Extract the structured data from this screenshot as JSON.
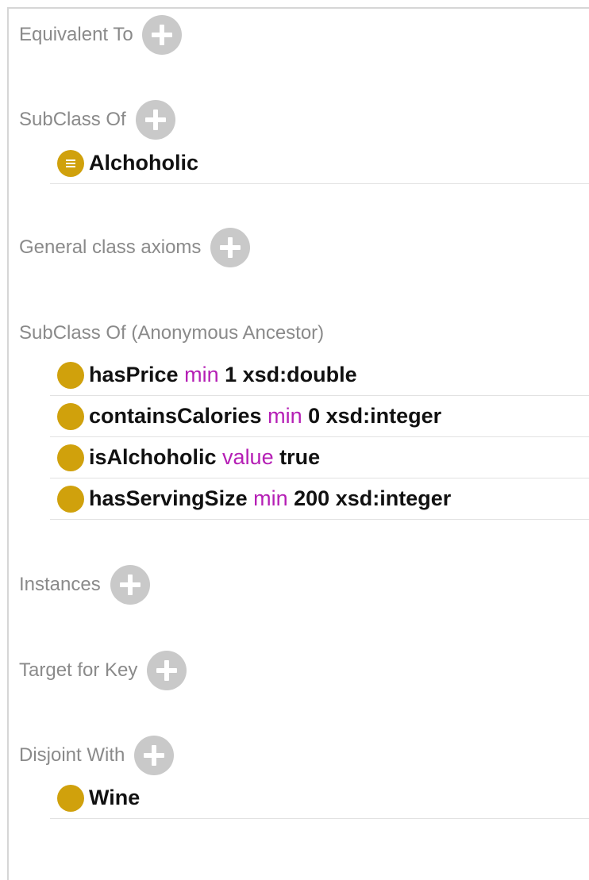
{
  "sections": {
    "equivalent_to": {
      "label": "Equivalent To"
    },
    "subclass_of": {
      "label": "SubClass Of",
      "items": [
        {
          "text": "Alchoholic"
        }
      ]
    },
    "general_class_axioms": {
      "label": "General class axioms"
    },
    "subclass_of_anonymous": {
      "label": "SubClass Of (Anonymous Ancestor)",
      "items": [
        {
          "property": "hasPrice",
          "keyword": "min",
          "value": "1 xsd:double"
        },
        {
          "property": "containsCalories",
          "keyword": "min",
          "value": "0 xsd:integer"
        },
        {
          "property": "isAlchoholic",
          "keyword": "value",
          "value": "true"
        },
        {
          "property": "hasServingSize",
          "keyword": "min",
          "value": "200 xsd:integer"
        }
      ]
    },
    "instances": {
      "label": "Instances"
    },
    "target_for_key": {
      "label": "Target for Key"
    },
    "disjoint_with": {
      "label": "Disjoint With",
      "items": [
        {
          "text": "Wine"
        }
      ]
    }
  },
  "colors": {
    "bullet": "#d0a10c",
    "keyword": "#b51fb5",
    "label": "#8a8a8a",
    "add_button": "#c9c9c9"
  },
  "icons": {
    "add": "plus-circle-icon",
    "equivalent_class": "equivalent-class-icon",
    "class": "class-circle-icon"
  }
}
